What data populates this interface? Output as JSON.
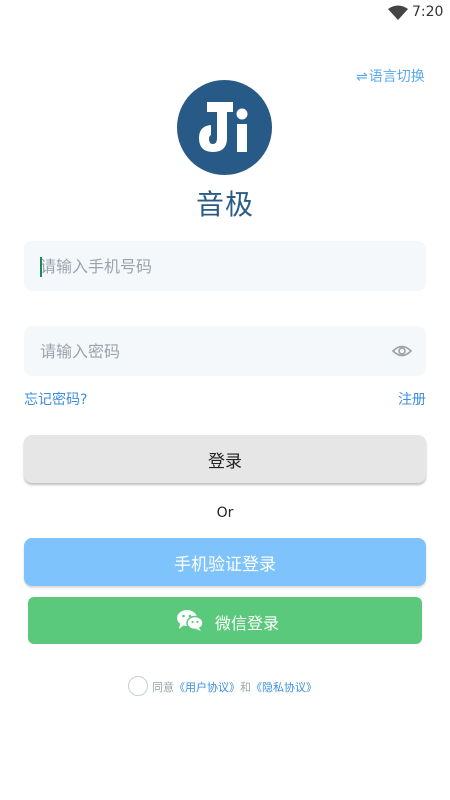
{
  "status_bar": {
    "time": "7:20"
  },
  "header": {
    "language_switch": "语言切换",
    "language_icon": "⇌"
  },
  "app": {
    "name": "音极"
  },
  "form": {
    "phone_placeholder": "请输入手机号码",
    "password_placeholder": "请输入密码",
    "forgot_password": "忘记密码?",
    "register": "注册"
  },
  "actions": {
    "login": "登录",
    "or": "Or",
    "sms_login": "手机验证登录",
    "wechat_login": "微信登录"
  },
  "agreement": {
    "prefix": "同意",
    "user_agreement": "《用户协议》",
    "and": "和",
    "privacy_agreement": "《隐私协议》",
    "checked": false
  },
  "colors": {
    "brand": "#275a87",
    "link": "#3d8ee0",
    "sms_button": "#7fc3fc",
    "wechat_button": "#5ac97c"
  },
  "icons": [
    "wifi-icon",
    "language-switch-icon",
    "app-logo",
    "eye-icon",
    "wechat-icon"
  ]
}
